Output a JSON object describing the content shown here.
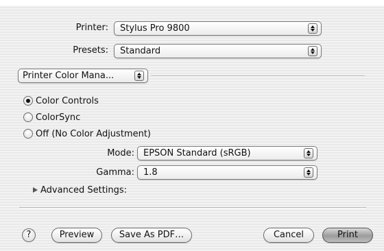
{
  "printer": {
    "label": "Printer:",
    "value": "Stylus Pro 9800"
  },
  "presets": {
    "label": "Presets:",
    "value": "Standard"
  },
  "panel_popup": {
    "value": "Printer Color Mana..."
  },
  "color_options": {
    "items": [
      {
        "label": "Color Controls",
        "selected": true
      },
      {
        "label": "ColorSync",
        "selected": false
      },
      {
        "label": "Off (No Color Adjustment)",
        "selected": false
      }
    ]
  },
  "mode": {
    "label": "Mode:",
    "value": "EPSON Standard (sRGB)"
  },
  "gamma": {
    "label": "Gamma:",
    "value": "1.8"
  },
  "advanced": {
    "label": "Advanced Settings:"
  },
  "footer": {
    "help_label": "?",
    "preview_label": "Preview",
    "save_pdf_label": "Save As PDF…",
    "cancel_label": "Cancel",
    "print_label": "Print"
  },
  "icons": {
    "help": "question-mark-icon",
    "popup_arrows": "up-down-arrows-icon",
    "disclosure": "disclosure-triangle-icon"
  }
}
